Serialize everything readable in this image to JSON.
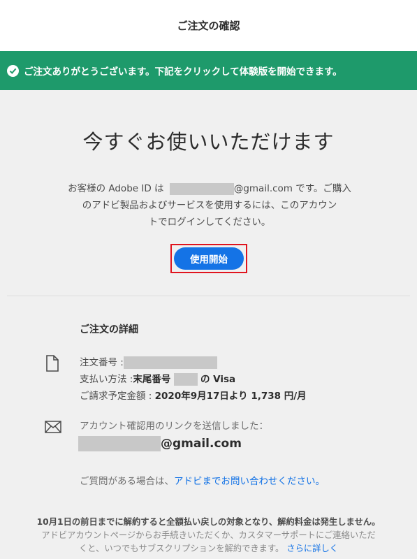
{
  "header": {
    "title": "ご注文の確認"
  },
  "banner": {
    "text": "ご注文ありがとうございます。下記をクリックして体験版を開始できます。",
    "color": "#1e9a6b"
  },
  "main": {
    "headline": "今すぐお使いいただけます",
    "intro_pre": "お客様の Adobe ID は",
    "intro_email_suffix": "@gmail.com",
    "intro_post": "です。ご購入",
    "intro_line2": "のアドビ製品およびサービスを使用するには、このアカウン",
    "intro_line3": "トでログインしてください。",
    "start_button": "使用開始",
    "accent": "#1473e6"
  },
  "details": {
    "title": "ご注文の詳細",
    "order_number_label": "注文番号 :",
    "payment_label": "支払い方法 :",
    "payment_prefix": "末尾番号",
    "payment_suffix": "の Visa",
    "billing_label": "ご請求予定金額 :",
    "billing_value": "2020年9月17日より 1,738 円/月",
    "email_sent_text": "アカウント確認用のリンクを送信しました：",
    "email_suffix": "@gmail.com",
    "question_text": "ご質問がある場合は、",
    "question_link": "アドビまでお問い合わせください。"
  },
  "footer": {
    "line1": "10月1日の前日までに解約すると全額払い戻しの対象となり、解約料金は発生しません。",
    "line2": "アドビアカウントページからお手続きいただくか、カスタマーサポートにご連絡いただ",
    "line3": "くと、いつでもサブスクリプションを解約できます。",
    "more_link": "さらに詳しく"
  }
}
